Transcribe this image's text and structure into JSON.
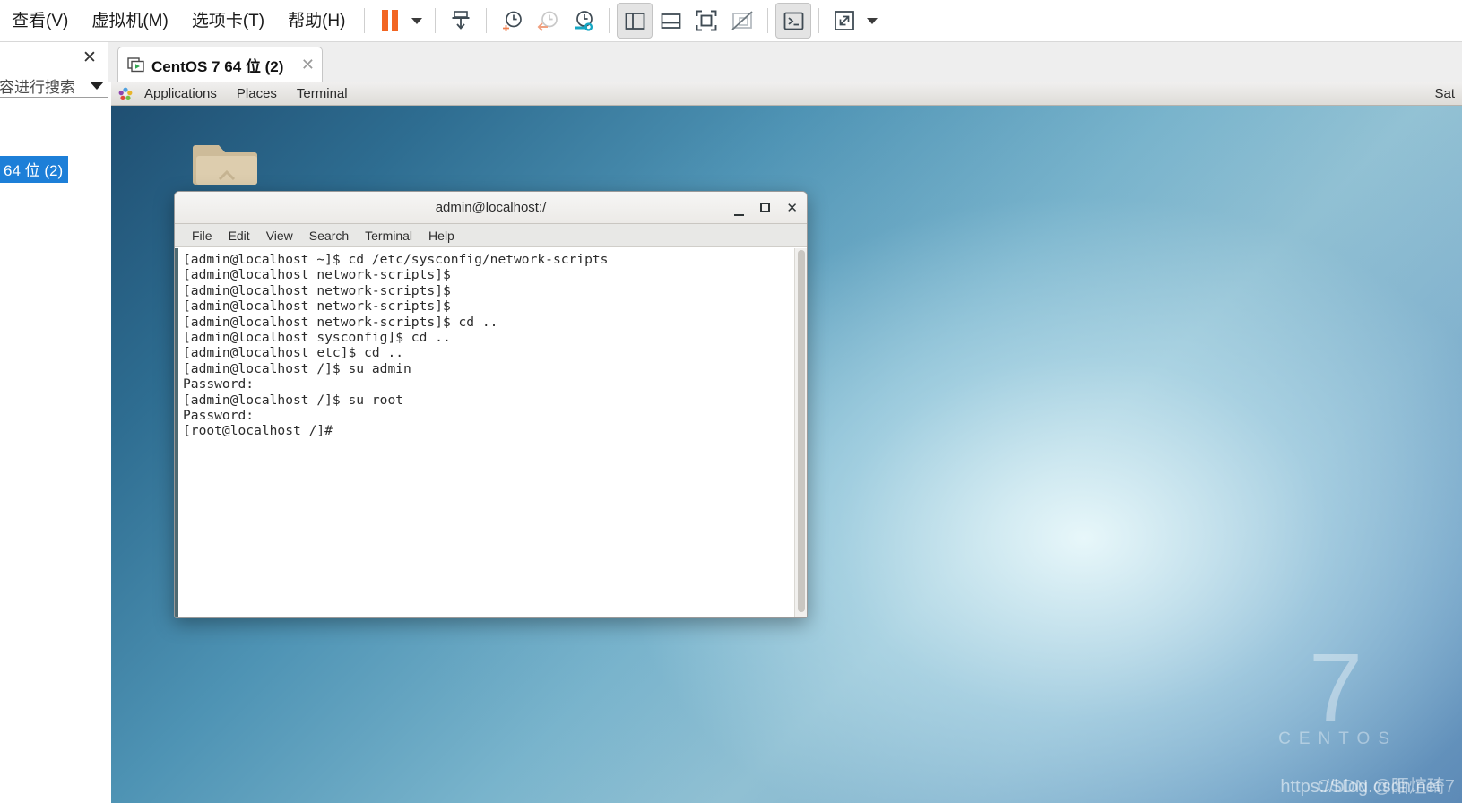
{
  "vmware": {
    "menu_items": [
      {
        "label": "查看(V)",
        "name": "menu-view"
      },
      {
        "label": "虚拟机(M)",
        "name": "menu-vm"
      },
      {
        "label": "选项卡(T)",
        "name": "menu-tabs"
      },
      {
        "label": "帮助(H)",
        "name": "menu-help"
      }
    ],
    "toolbar": [
      {
        "name": "pause-button",
        "icon": "pause-icon",
        "active": false
      },
      {
        "name": "pause-dropdown-button",
        "icon": "chevron-down-icon",
        "active": false
      },
      {
        "name": "snapshot-button",
        "icon": "snapshot-save-icon",
        "active": false
      },
      {
        "name": "take-snapshot-button",
        "icon": "clock-plus-icon",
        "active": false
      },
      {
        "name": "revert-snapshot-button",
        "icon": "clock-back-icon",
        "active": false
      },
      {
        "name": "manage-snapshots-button",
        "icon": "clock-wrench-icon",
        "active": false
      },
      {
        "name": "show-library-button",
        "icon": "sidebar-panel-icon",
        "active": true
      },
      {
        "name": "show-thumbnail-bar-button",
        "icon": "bottom-panel-icon",
        "active": false
      },
      {
        "name": "fullscreen-button",
        "icon": "fullscreen-icon",
        "active": false
      },
      {
        "name": "unity-mode-button",
        "icon": "unity-disabled-icon",
        "active": false
      },
      {
        "name": "console-button",
        "icon": "terminal-prompt-icon",
        "active": true
      },
      {
        "name": "expand-button",
        "icon": "expand-arrows-icon",
        "active": false
      },
      {
        "name": "expand-dropdown-button",
        "icon": "chevron-down-icon",
        "active": false
      }
    ]
  },
  "library": {
    "close_label": "✕",
    "search_value": "容进行搜索",
    "selected_item_label": "64 位 (2)"
  },
  "tab": {
    "label": "CentOS 7 64 位 (2)",
    "close_label": "✕",
    "icon": "vm-screen-icon"
  },
  "guest": {
    "gnome_bar": {
      "applications": "Applications",
      "places": "Places",
      "terminal": "Terminal",
      "clock": "Sat"
    },
    "desktop": {
      "folder_icon": "folder-icon",
      "watermark_number": "7",
      "watermark_word": "CENTOS",
      "csdn_watermark": "https://blog.csdn.net",
      "csdn_watermark_overlay": "CSDN @陌煊琦7"
    },
    "terminal_window": {
      "title": "admin@localhost:/",
      "buttons": {
        "minimize": "minimize-button",
        "maximize": "maximize-button",
        "close": "close-button"
      },
      "menu": [
        "File",
        "Edit",
        "View",
        "Search",
        "Terminal",
        "Help"
      ],
      "lines": [
        "[admin@localhost ~]$ cd /etc/sysconfig/network-scripts",
        "[admin@localhost network-scripts]$",
        "[admin@localhost network-scripts]$",
        "[admin@localhost network-scripts]$",
        "[admin@localhost network-scripts]$ cd ..",
        "[admin@localhost sysconfig]$ cd ..",
        "[admin@localhost etc]$ cd ..",
        "[admin@localhost /]$ su admin",
        "Password:",
        "[admin@localhost /]$ su root",
        "Password:",
        "[root@localhost /]#"
      ]
    }
  },
  "colors": {
    "accent_orange": "#f26522",
    "selection_blue": "#1d7fd8",
    "terminal_text": "#2c2c2c"
  }
}
